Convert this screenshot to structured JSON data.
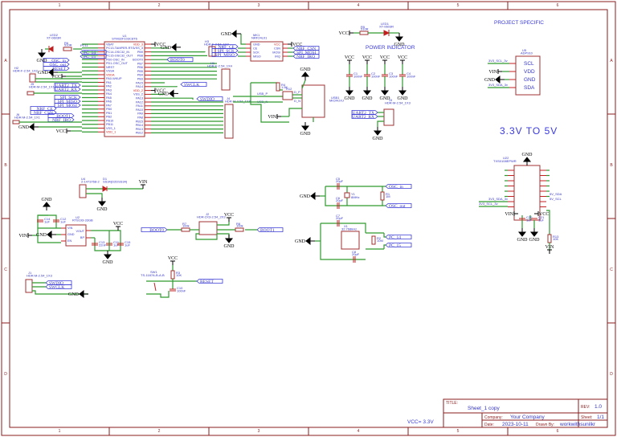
{
  "frame": {
    "columns": [
      "1",
      "2",
      "3",
      "4",
      "5",
      "6"
    ],
    "rows": [
      "A",
      "B",
      "C",
      "D"
    ]
  },
  "title_block": {
    "title_label": "TITLE:",
    "title": "Sheet_1 copy",
    "rev_label": "REV:",
    "rev": "1.0",
    "company_label": "Company:",
    "company": "Your Company",
    "sheet_label": "Sheet:",
    "sheet": "1/1",
    "date_label": "Date:",
    "date": "2023-10-11",
    "drawn_label": "Drawn By:",
    "drawn_by": "workwithsunilkr"
  },
  "annotations": {
    "project_specific": "PROJECT SPECIFIC",
    "power_indicator": "POWER INDICATOR",
    "level_shift": "3.3V TO 5V",
    "vcc_note": "VCC= 3.3V"
  },
  "nets": {
    "gnd": "GND",
    "vcc": "VCC",
    "vin": "VIN"
  },
  "labels": {
    "pc14": "PC_14",
    "pc15": "PC_15",
    "osc_in": "OSC_in",
    "osc_out": "OSC_out",
    "reset": "RESET",
    "uart2_tx": "UART2_TX",
    "uart2_rx": "UART2_RX",
    "spi_sck": "SPI_SCK",
    "spi_miso": "SPI_MISO",
    "spi_mosi": "SPI_MOSI",
    "nrf_ce": "NRF_CE",
    "nrf_csn": "NRF_CSN",
    "nrf_irq": "NRF_IRQ",
    "boot0": "BOOT0",
    "boot1": "BOOT1",
    "swclk": "SWCLK",
    "swdio": "SWDIO",
    "usb_p": "USB_P",
    "usb_n": "USB_N",
    "d_p": "D_P",
    "d_n": "D_N",
    "sda_3v": "3V3_SDA_3v",
    "scl_3v": "3V3_SCL_3v",
    "sda_5v": "5V_SDA",
    "scl_5v": "5V_SCL",
    "pc_14b": "PC_14",
    "pc_15b": "PC_15"
  },
  "u1": {
    "ref": "U1",
    "part": "STM32F103C8T6",
    "left_pins": [
      "VBAT",
      "PC13-TAMPER-RTC",
      "PC14-OSC32_IN",
      "PC15-OSC32_OUT",
      "PD0-OSC_IN",
      "PD1-OSC_OUT",
      "NRST",
      "VSSA",
      "VDDA",
      "PA0-WKUP",
      "PA1",
      "PA2",
      "PA3",
      "PA4",
      "PA5",
      "PA6",
      "PA7",
      "PB0",
      "PB1",
      "PB2",
      "PB10",
      "PB11",
      "VSS_1",
      "VDD_1"
    ],
    "right_pins": [
      "VDD_3",
      "VSS_3",
      "PB9",
      "PB8",
      "BOOT0",
      "PB7",
      "PB6",
      "PB5",
      "PB4",
      "PB3",
      "PA15",
      "PA14",
      "VDD_2",
      "VSS_2",
      "PA13",
      "PA12",
      "PA11",
      "PA10",
      "PA9",
      "PA8",
      "PB15",
      "PB14",
      "PB13",
      "PB12"
    ]
  },
  "u5": {
    "ref": "U5",
    "part": "ADP910",
    "pins": [
      "SCL",
      "VDD",
      "GND",
      "SDA"
    ]
  },
  "components": {
    "led2": {
      "ref": "LED2",
      "value": "XT-0603R"
    },
    "r6": {
      "ref": "R6",
      "value": "510R"
    },
    "pc11": {
      "ref": "PC11"
    },
    "h2": {
      "ref": "H2",
      "value": "HDR-F-2.54_1X2"
    },
    "j5": {
      "ref": "J5",
      "value": "HDR-M-2.54_1X1"
    },
    "j6": {
      "ref": "J6",
      "value": "HDR-M-2.54_1X1"
    },
    "h3": {
      "ref": "H3",
      "value": "HDR-F-2.54_1X2"
    },
    "h1": {
      "ref": "H1",
      "value": "HDR-F-2.54_1X4"
    },
    "j4": {
      "ref": "J4",
      "value": "HDR-M-2.54_1X8"
    },
    "mk1": {
      "ref": "MK1",
      "value": "NRF24L01",
      "pins_left": [
        "GND",
        "CE",
        "SCK",
        "MISO"
      ],
      "pins_right": [
        "VCC",
        "CSN",
        "MOSI",
        "IRQ"
      ]
    },
    "r5": {
      "ref": "R5",
      "value": "510R"
    },
    "led1": {
      "ref": "LED1",
      "value": "XT-0603R"
    },
    "c1": {
      "ref": "C1",
      "value": "100nF"
    },
    "c2": {
      "ref": "C2",
      "value": "100nF"
    },
    "c3": {
      "ref": "C3",
      "value": "100nF"
    },
    "c4": {
      "ref": "C4",
      "value": "100nF"
    },
    "r2": {
      "ref": "R12",
      "value": "22R"
    },
    "r4": {
      "ref": "R4",
      "value": "1.5K"
    },
    "usb1": {
      "ref": "USB1",
      "value": "MICROXJ"
    },
    "j3": {
      "ref": "J3",
      "value": "HDR-M-2.54_1X3"
    },
    "u22": {
      "ref": "U22",
      "value": "TXS0108EPWR"
    },
    "c20": {
      "ref": "C20",
      "value": "1uF"
    },
    "c21": {
      "ref": "C21",
      "value": "1uF"
    },
    "r13": {
      "ref": "R13",
      "value": "10K"
    },
    "u4": {
      "ref": "U4",
      "value": "2-1473768-2"
    },
    "d1": {
      "ref": "D1",
      "value": "SS34(D2DSS34)"
    },
    "u2": {
      "ref": "U2",
      "value": "RT9193-33GB",
      "pins": [
        "VIN",
        "GND",
        "EN",
        "VOUT",
        "BP"
      ]
    },
    "c14": {
      "ref": "C14",
      "value": "1uF"
    },
    "c12": {
      "ref": "C12",
      "value": "1uF"
    },
    "c13": {
      "ref": "C13",
      "value": "22nF"
    },
    "c11": {
      "ref": "C11",
      "value": "1uF"
    },
    "c15": {
      "ref": "C15",
      "value": "1uF"
    },
    "j1": {
      "ref": "J1",
      "value": "HDR-M-2.54_1X3"
    },
    "j2": {
      "ref": "J2",
      "value": "HDR-2X3-2.54_2X3"
    },
    "r7": {
      "ref": "R7",
      "value": "100k"
    },
    "r8": {
      "ref": "R8",
      "value": "100k"
    },
    "sw1": {
      "ref": "SW1",
      "value": "TS-1187A-B-A-B"
    },
    "r3": {
      "ref": "R3",
      "value": "10K"
    },
    "c10": {
      "ref": "C10",
      "value": "100nF"
    },
    "c5": {
      "ref": "C5",
      "value": "20pF"
    },
    "c6": {
      "ref": "C6",
      "value": "20pF"
    },
    "y1": {
      "ref": "Y1",
      "value": "8MHz"
    },
    "r1": {
      "ref": "R1",
      "value": "1M"
    },
    "c7": {
      "ref": "C7",
      "value": "20pF"
    },
    "x1": {
      "ref": "X1",
      "value": "32.768kHz"
    },
    "c8": {
      "ref": "C8",
      "value": "20pF"
    },
    "r2b": {
      "ref": "R2",
      "value": "10M"
    }
  }
}
